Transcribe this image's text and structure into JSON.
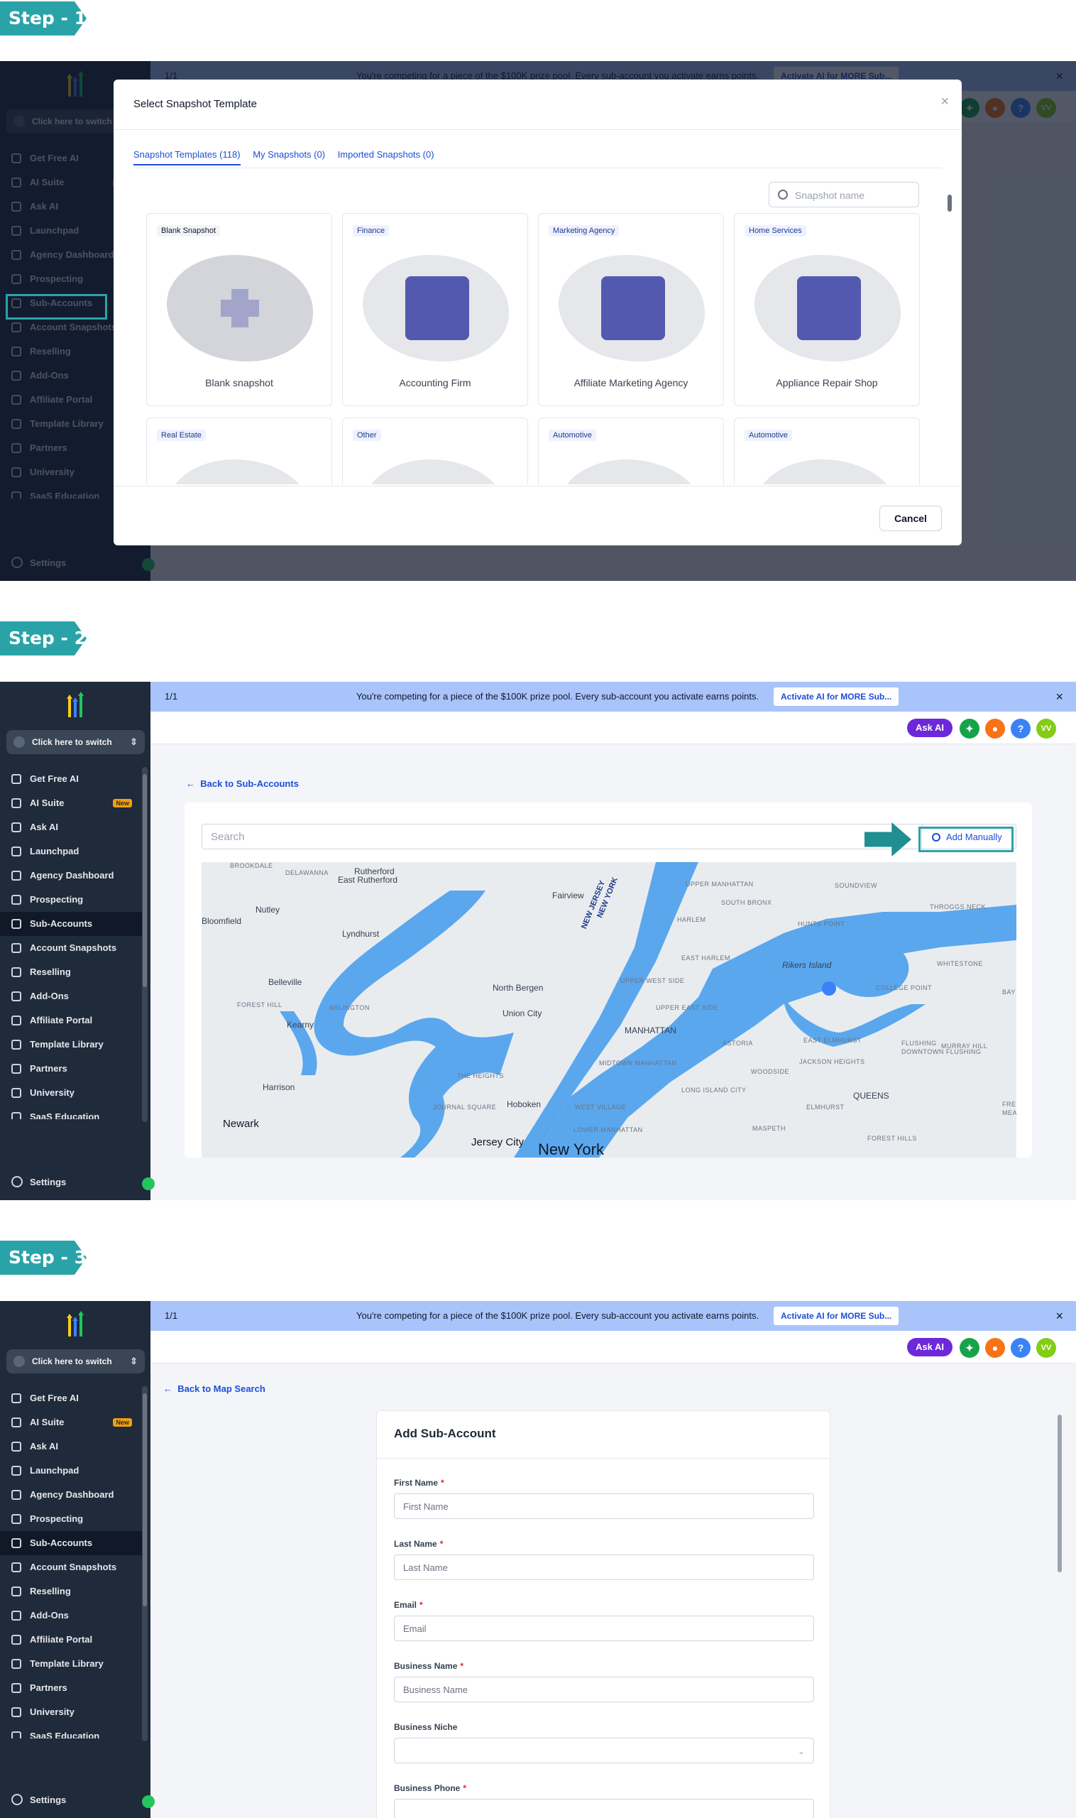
{
  "steps": [
    "Step - 1",
    "Step - 2",
    "Step - 3"
  ],
  "sidebar": {
    "switcher_label": "Click here to switch",
    "items": [
      {
        "label": "Get Free AI"
      },
      {
        "label": "AI Suite",
        "badge": "New"
      },
      {
        "label": "Ask AI"
      },
      {
        "label": "Launchpad"
      },
      {
        "label": "Agency Dashboard"
      },
      {
        "label": "Prospecting"
      },
      {
        "label": "Sub-Accounts"
      },
      {
        "label": "Account Snapshots"
      },
      {
        "label": "Reselling"
      },
      {
        "label": "Add-Ons"
      },
      {
        "label": "Affiliate Portal"
      },
      {
        "label": "Template Library"
      },
      {
        "label": "Partners"
      },
      {
        "label": "University"
      },
      {
        "label": "SaaS Education"
      }
    ],
    "settings_label": "Settings"
  },
  "banner": {
    "pager": "1/1",
    "text": "You're competing for a piece of the $100K prize pool. Every sub-account you activate earns points.",
    "action": "Activate AI for MORE Sub...",
    "close": "×"
  },
  "topbar": {
    "ask_ai": "Ask AI",
    "help": "?",
    "avatar": "VV"
  },
  "modal": {
    "title": "Select Snapshot Template",
    "close": "×",
    "tabs": [
      "Snapshot Templates (118)",
      "My Snapshots (0)",
      "Imported Snapshots (0)"
    ],
    "search_placeholder": "Snapshot name",
    "cards": [
      {
        "tag": "Blank Snapshot",
        "name": "Blank snapshot"
      },
      {
        "tag": "Finance",
        "name": "Accounting Firm"
      },
      {
        "tag": "Marketing Agency",
        "name": "Affiliate Marketing Agency"
      },
      {
        "tag": "Home Services",
        "name": "Appliance Repair Shop"
      },
      {
        "tag": "Real Estate",
        "name": ""
      },
      {
        "tag": "Other",
        "name": ""
      },
      {
        "tag": "Automotive",
        "name": ""
      },
      {
        "tag": "Automotive",
        "name": ""
      }
    ],
    "cancel": "Cancel"
  },
  "step2": {
    "back_link": "Back to Sub-Accounts",
    "search_placeholder": "Search",
    "add_manually": "Add Manually",
    "map_labels": [
      "Rutherford",
      "East Rutherford",
      "DELAWANNA",
      "BROOKDALE",
      "Nutley",
      "Bloomfield",
      "Lyndhurst",
      "Belleville",
      "FOREST HILL",
      "ARLINGTON",
      "Kearny",
      "North Bergen",
      "Union City",
      "Harrison",
      "Newark",
      "THE HEIGHTS",
      "JOURNAL SQUARE",
      "Hoboken",
      "Jersey City",
      "New York",
      "WEST VILLAGE",
      "LOWER MANHATTAN",
      "MIDTOWN MANHATTAN",
      "MANHATTAN",
      "UPPER WEST SIDE",
      "UPPER EAST SIDE",
      "EAST HARLEM",
      "HARLEM",
      "UPPER MANHATTAN",
      "SOUTH BRONX",
      "HUNTS POINT",
      "SOUNDVIEW",
      "THROGGS NECK",
      "Rikers Island",
      "WHITESTONE",
      "COLLEGE POINT",
      "ASTORIA",
      "LONG ISLAND CITY",
      "WOODSIDE",
      "JACKSON HEIGHTS",
      "EAST ELMHURST",
      "FLUSHING",
      "DOWNTOWN FLUSHING",
      "MURRAY HILL",
      "QUEENS",
      "ELMHURST",
      "MASPETH",
      "FOREST HILLS",
      "Fairview",
      "NEW JERSEY",
      "NEW YORK",
      "BAY",
      "FRE",
      "MEA"
    ]
  },
  "step3": {
    "back_link": "Back to Map Search",
    "form_title": "Add Sub-Account",
    "fields": [
      {
        "label": "First Name",
        "required": "*",
        "placeholder": "First Name"
      },
      {
        "label": "Last Name",
        "required": "*",
        "placeholder": "Last Name"
      },
      {
        "label": "Email",
        "required": "*",
        "placeholder": "Email"
      },
      {
        "label": "Business Name",
        "required": "*",
        "placeholder": "Business Name"
      },
      {
        "label": "Business Niche",
        "required": "",
        "placeholder": ""
      },
      {
        "label": "Business Phone",
        "required": "*",
        "placeholder": ""
      }
    ]
  },
  "colors": {
    "step_badge": "#2aa3a8",
    "sidebar": "#1f2a3a",
    "banner": "#a9c3fb",
    "link": "#1d4ed8",
    "ask_ai": "#6d28d9",
    "water": "#5aa7ee"
  }
}
